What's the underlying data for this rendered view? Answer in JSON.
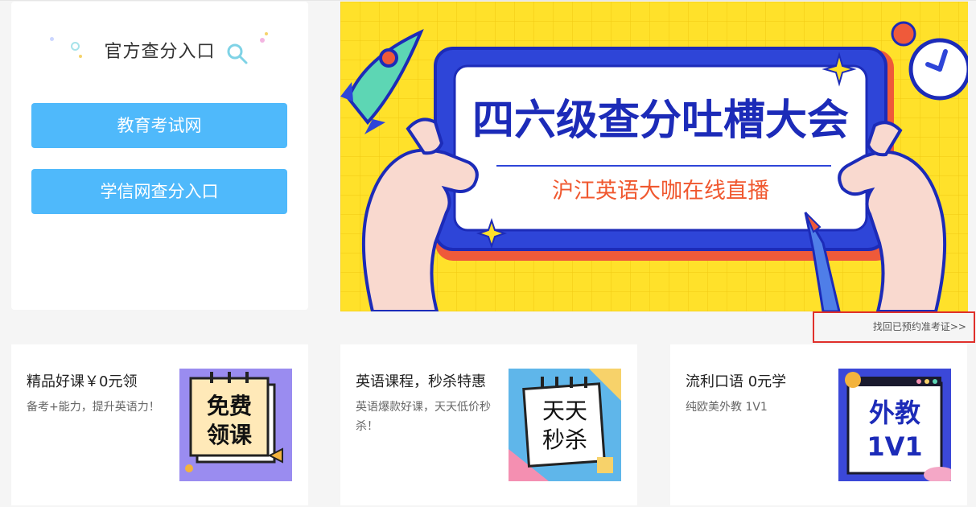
{
  "official": {
    "title": "官方查分入口",
    "buttons": [
      "教育考试网",
      "学信网查分入口"
    ]
  },
  "banner": {
    "title": "四六级查分吐槽大会",
    "subtitle": "沪江英语大咖在线直播",
    "colors": {
      "background": "#ffe12a",
      "frame": "#2e45d8",
      "title": "#1c2bb8",
      "subtitle": "#f0582f"
    }
  },
  "ticket_link": {
    "label": "找回已预约准考证>>"
  },
  "cards": [
    {
      "title": "精品好课￥0元领",
      "desc": "备考+能力，提升英语力！",
      "image_text": [
        "免费",
        "领课"
      ],
      "image_icon": "notebook-icon"
    },
    {
      "title": "英语课程，秒杀特惠",
      "desc": "英语爆款好课，天天低价秒杀！",
      "image_text": [
        "天天",
        "秒杀"
      ],
      "image_icon": "notebook-icon"
    },
    {
      "title": "流利口语 0元学",
      "desc": "纯欧美外教 1V1",
      "image_text": [
        "外教",
        "1V1"
      ],
      "image_icon": "browser-window-icon"
    }
  ],
  "colors": {
    "accent_button": "#4fb9fb",
    "link_border": "#e0302b"
  }
}
